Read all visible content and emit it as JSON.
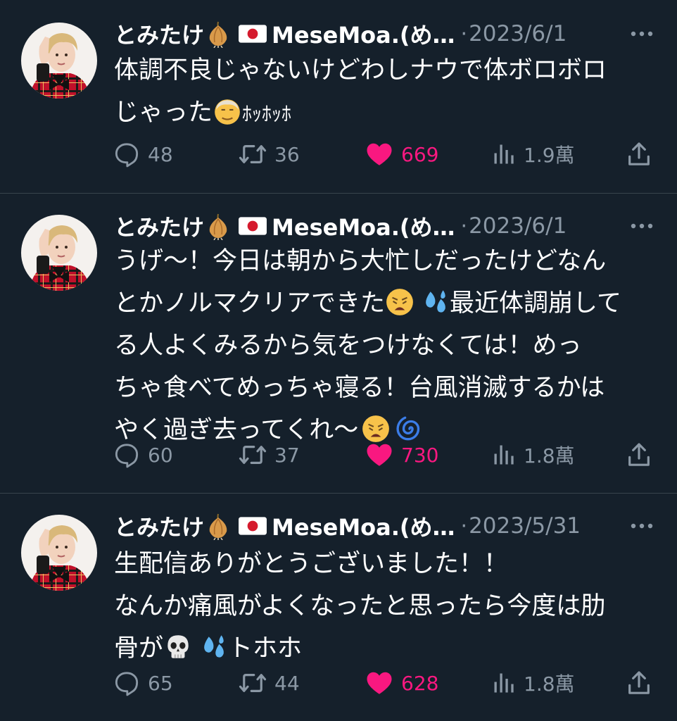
{
  "colors": {
    "background": "#15202b",
    "divider": "#38444d",
    "secondary_text": "#8b98a5",
    "like_active": "#f91880"
  },
  "tweets": [
    {
      "author": {
        "display_name": "とみたけ",
        "handle_part": "MeseMoa.(め…",
        "name_emojis": [
          "onion-emoji",
          "japan-flag-emoji"
        ]
      },
      "date": "2023/6/1",
      "body_lines": [
        "体調不良じゃないけどわしナウで体ボロボロ",
        "じゃった",
        "ﾎｯﾎｯﾎ"
      ],
      "stats": {
        "replies": "48",
        "retweets": "36",
        "likes": "669",
        "views": "1.9萬"
      }
    },
    {
      "author": {
        "display_name": "とみたけ",
        "handle_part": "MeseMoa.(め…",
        "name_emojis": [
          "onion-emoji",
          "japan-flag-emoji"
        ]
      },
      "date": "2023/6/1",
      "body_lines": [
        "うげ～！今日は朝から大忙しだったけどなん",
        "とかノルマクリアできた",
        "最近体調崩して",
        "る人よくみるから気をつけなくては！めっ",
        "ちゃ食べてめっちゃ寝る！台風消滅するかは",
        "やく過ぎ去ってくれ～"
      ],
      "stats": {
        "replies": "60",
        "retweets": "37",
        "likes": "730",
        "views": "1.8萬"
      }
    },
    {
      "author": {
        "display_name": "とみたけ",
        "handle_part": "MeseMoa.(め…",
        "name_emojis": [
          "onion-emoji",
          "japan-flag-emoji"
        ]
      },
      "date": "2023/5/31",
      "body_lines": [
        "生配信ありがとうございました！！",
        "なんか痛風がよくなったと思ったら今度は肋",
        "骨が",
        "トホホ"
      ],
      "stats": {
        "replies": "65",
        "retweets": "44",
        "likes": "628",
        "views": "1.8萬"
      }
    }
  ]
}
